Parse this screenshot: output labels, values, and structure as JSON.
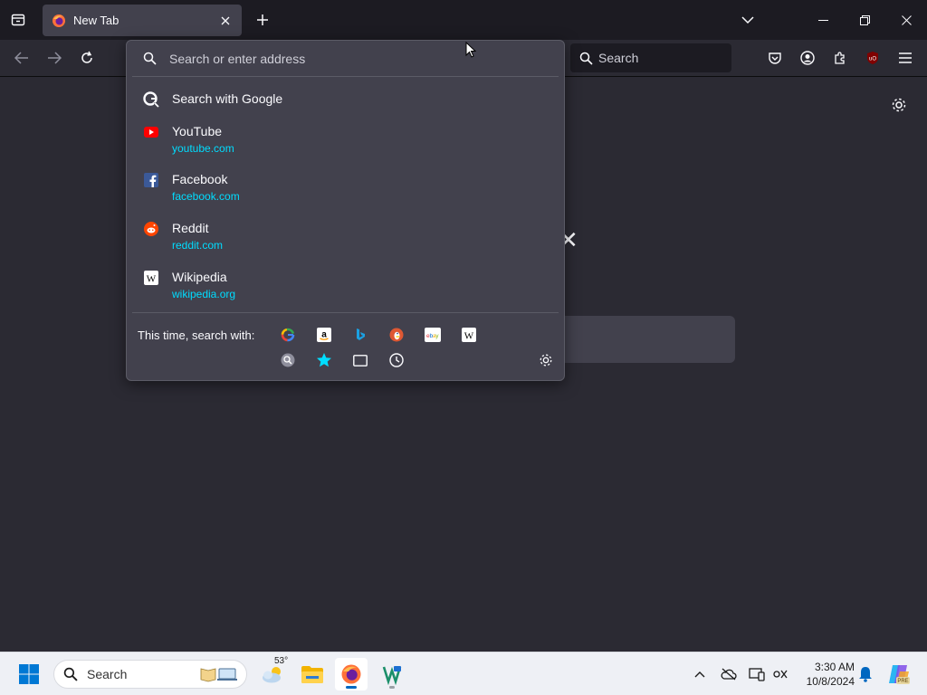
{
  "tabbar": {
    "tab_title": "New Tab",
    "list_all_tabs_icon": "chevron-down-icon",
    "window_controls": [
      "minimize",
      "restore",
      "close"
    ]
  },
  "navbar": {
    "search_placeholder": "Search"
  },
  "urlbar": {
    "placeholder": "Search or enter address",
    "results": [
      {
        "title": "Search with Google",
        "url": "",
        "icon": "google-icon"
      },
      {
        "title": "YouTube",
        "url": "youtube.com",
        "icon": "youtube-icon"
      },
      {
        "title": "Facebook",
        "url": "facebook.com",
        "icon": "facebook-icon"
      },
      {
        "title": "Reddit",
        "url": "reddit.com",
        "icon": "reddit-icon"
      },
      {
        "title": "Wikipedia",
        "url": "wikipedia.org",
        "icon": "wikipedia-icon"
      }
    ],
    "oneoff_label": "This time, search with:",
    "engines": [
      "google",
      "amazon",
      "bing",
      "duckduckgo",
      "ebay",
      "wikipedia"
    ],
    "modes": [
      "search-history",
      "bookmarks",
      "tabs",
      "history"
    ]
  },
  "taskbar": {
    "search_placeholder": "Search",
    "weather_temp": "53°",
    "time": "3:30 AM",
    "date": "10/8/2024"
  },
  "colors": {
    "accent_link": "#00ddff",
    "panel": "#42414d",
    "chrome_dark": "#1c1b22",
    "page_bg": "#2b2a33"
  }
}
